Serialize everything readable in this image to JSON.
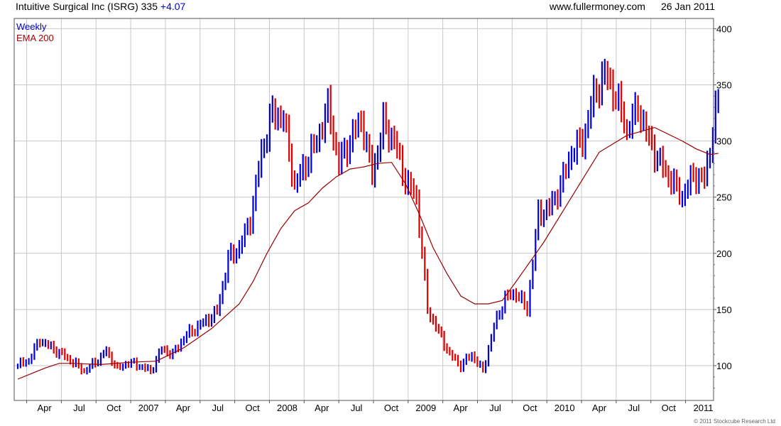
{
  "header": {
    "company": "Intuitive Surgical Inc",
    "ticker": "(ISRG)",
    "last": "335",
    "change": "+4.07",
    "site": "www.fullermoney.com",
    "date": "26 Jan 2011"
  },
  "copyright": "© 2011 Stockcube Research Ltd",
  "colors": {
    "up": "#0000dd",
    "down": "#dd0000",
    "ema": "#990000",
    "grid": "#c8c8c8",
    "frame": "#555555",
    "legend_weekly": "#0000cc",
    "legend_ema": "#aa0000"
  },
  "chart_data": {
    "type": "line",
    "chart_style": "weekly high-low-close price bars (blue = up week, red = down week) with 200-period exponential moving average",
    "legend": [
      {
        "label": "Weekly",
        "color": "#0000cc"
      },
      {
        "label": "EMA 200",
        "color": "#aa0000"
      }
    ],
    "y_axis": {
      "position": "right",
      "ylim": [
        75,
        408
      ],
      "ticks": [
        100,
        150,
        200,
        250,
        300,
        350,
        400
      ]
    },
    "x_axis": {
      "labels": [
        "Apr",
        "Jul",
        "Oct",
        "2007",
        "Apr",
        "Jul",
        "Oct",
        "2008",
        "Apr",
        "Jul",
        "Oct",
        "2009",
        "Apr",
        "Jul",
        "Oct",
        "2010",
        "Apr",
        "Jul",
        "Oct",
        "2011"
      ]
    },
    "grid": true,
    "price_series": {
      "name": "Weekly",
      "x": [
        0,
        4,
        8,
        12,
        16,
        20,
        24,
        28,
        32,
        36,
        40,
        44,
        48,
        52,
        56,
        60,
        64,
        68,
        72,
        76,
        80,
        84,
        88,
        92,
        96,
        100,
        104,
        108,
        112,
        116,
        120,
        124,
        128,
        132,
        136,
        140,
        144,
        148,
        152,
        156,
        160,
        164,
        168,
        172,
        176,
        180,
        184,
        188,
        192,
        196,
        200,
        204,
        208,
        212,
        216,
        220,
        224,
        228,
        232,
        236,
        240,
        244,
        248,
        252,
        253
      ],
      "close": [
        100,
        105,
        123,
        116,
        110,
        103,
        95,
        103,
        113,
        97,
        103,
        100,
        95,
        115,
        110,
        125,
        133,
        140,
        148,
        195,
        205,
        230,
        290,
        325,
        320,
        260,
        280,
        300,
        330,
        280,
        300,
        320,
        270,
        315,
        300,
        265,
        250,
        150,
        130,
        110,
        100,
        110,
        95,
        135,
        160,
        165,
        150,
        235,
        240,
        260,
        290,
        300,
        340,
        360,
        340,
        310,
        330,
        300,
        280,
        265,
        250,
        270,
        265,
        325,
        335
      ]
    },
    "ema_series": {
      "name": "EMA 200",
      "x": [
        0,
        5,
        10,
        15,
        20,
        30,
        40,
        50,
        60,
        70,
        80,
        85,
        90,
        95,
        100,
        105,
        110,
        115,
        120,
        125,
        130,
        135,
        140,
        145,
        150,
        155,
        160,
        165,
        170,
        175,
        180,
        190,
        200,
        210,
        220,
        230,
        240,
        245,
        250,
        253
      ],
      "values": [
        88,
        93,
        98,
        102,
        102,
        101,
        103,
        104,
        116,
        133,
        155,
        175,
        200,
        222,
        238,
        245,
        258,
        268,
        275,
        277,
        280,
        281,
        262,
        235,
        205,
        182,
        162,
        155,
        155,
        158,
        175,
        210,
        250,
        290,
        305,
        312,
        300,
        293,
        288,
        289
      ]
    }
  }
}
